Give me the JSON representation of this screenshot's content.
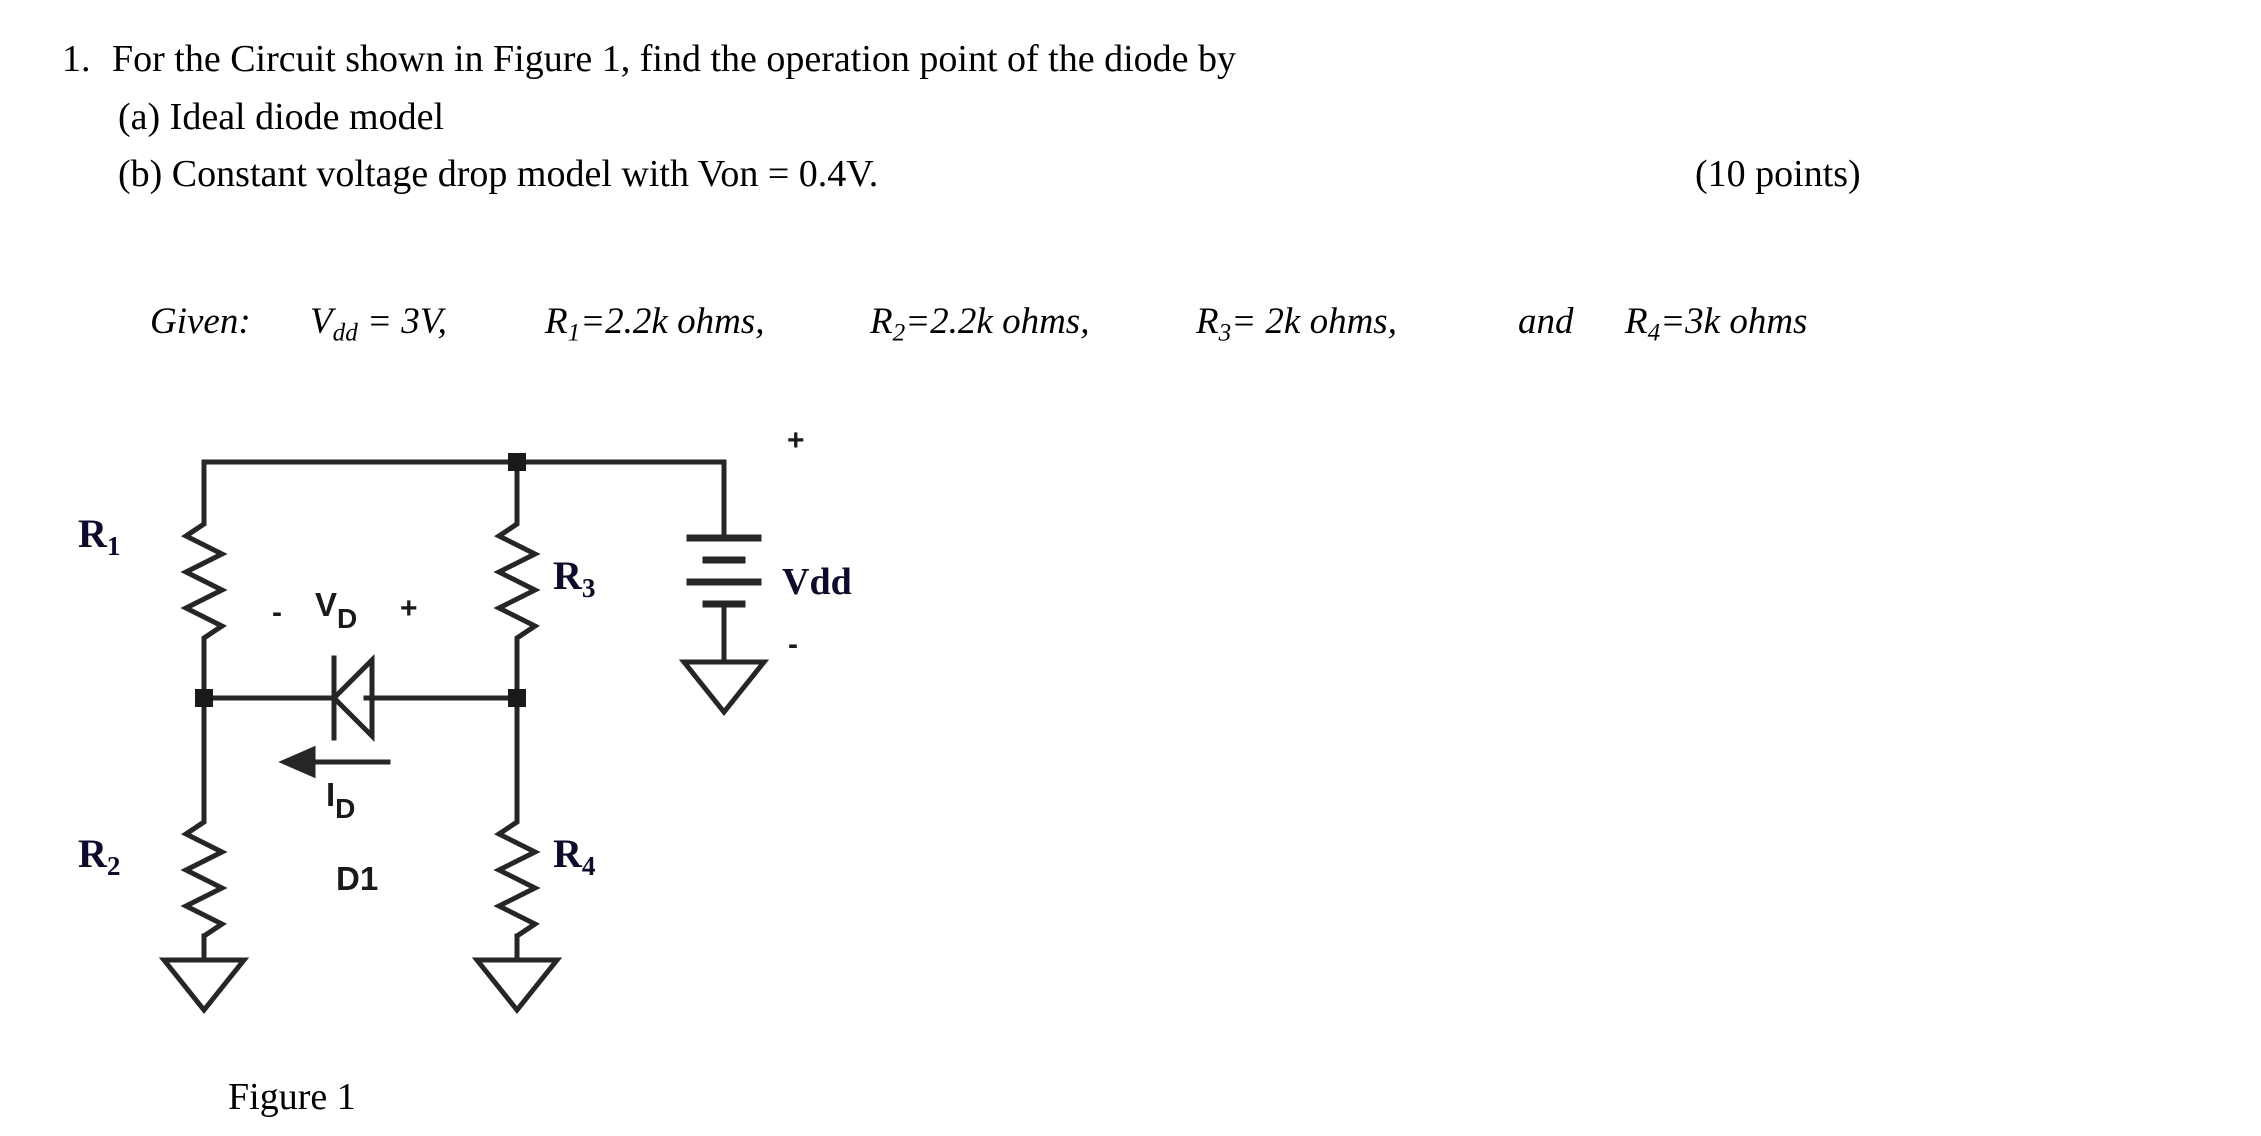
{
  "problem": {
    "number": "1.",
    "line1": "For the Circuit shown in Figure 1, find the operation point of the diode by",
    "line2": "(a) Ideal diode model",
    "line3": "(b) Constant voltage drop model with Von = 0.4V.",
    "points": "(10 points)"
  },
  "given": {
    "label": "Given:",
    "vdd": {
      "symbol": "V",
      "sub": "dd",
      "value": "= 3V,"
    },
    "r1": {
      "symbol": "R",
      "sub": "1",
      "value": "=2.2k ohms,"
    },
    "r2": {
      "symbol": "R",
      "sub": "2",
      "value": "=2.2k ohms,"
    },
    "r3": {
      "symbol": "R",
      "sub": "3",
      "value": "= 2k ohms,"
    },
    "and": "and",
    "r4": {
      "symbol": "R",
      "sub": "4",
      "value": "=3k ohms"
    }
  },
  "circuit": {
    "r1_label": "R",
    "r1_sub": "1",
    "r2_label": "R",
    "r2_sub": "2",
    "r3_label": "R",
    "r3_sub": "3",
    "r4_label": "R",
    "r4_sub": "4",
    "vd_minus": "-",
    "vd_label": "V",
    "vd_sub": "D",
    "vd_plus": "+",
    "id_label": "I",
    "id_sub": "D",
    "diode_ref": "D1",
    "source_label": "Vdd",
    "source_plus": "+",
    "source_minus": "-",
    "stroke_color": "#262626",
    "label_color": "#0d0d2b"
  },
  "figure": {
    "caption": "Figure 1"
  }
}
